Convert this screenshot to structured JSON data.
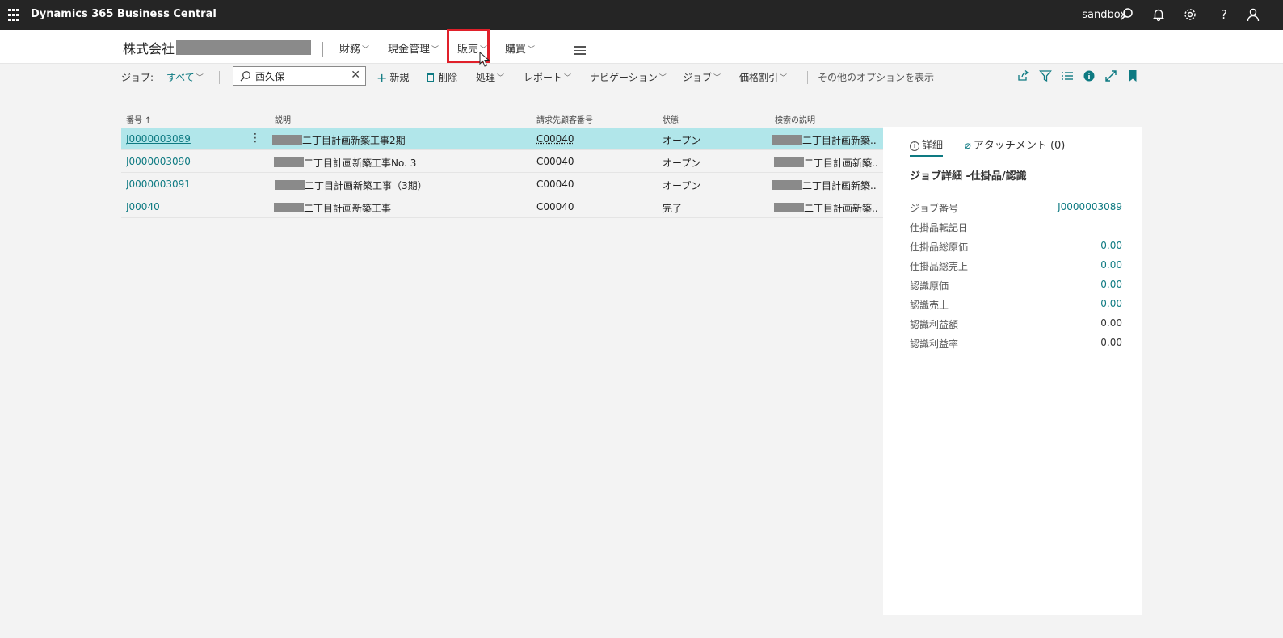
{
  "app": {
    "title": "Dynamics 365 Business Central",
    "environment": "sandbox"
  },
  "nav": {
    "company_prefix": "株式会社",
    "items": [
      {
        "label": "財務"
      },
      {
        "label": "現金管理"
      },
      {
        "label": "販売"
      },
      {
        "label": "購買"
      }
    ]
  },
  "actions": {
    "filter_label": "ジョブ:",
    "filter_value": "すべて",
    "search_value": "西久保",
    "new": "新規",
    "delete": "削除",
    "process": "処理",
    "report": "レポート",
    "navigation": "ナビゲーション",
    "job": "ジョブ",
    "price_discount": "価格割引",
    "more_options": "その他のオプションを表示"
  },
  "list": {
    "columns": [
      "番号 ↑",
      "説明",
      "請求先顧客番号",
      "状態",
      "検索の説明"
    ],
    "rows": [
      {
        "no": "J0000003089",
        "desc": "二丁目計画新築工事2期",
        "customer": "C00040",
        "status": "オープン",
        "search_desc": "二丁目計画新築..."
      },
      {
        "no": "J0000003090",
        "desc": "二丁目計画新築工事No. 3",
        "customer": "C00040",
        "status": "オープン",
        "search_desc": "二丁目計画新築..."
      },
      {
        "no": "J0000003091",
        "desc": "二丁目計画新築工事（3期）",
        "customer": "C00040",
        "status": "オープン",
        "search_desc": "二丁目計画新築..."
      },
      {
        "no": "J00040",
        "desc": "二丁目計画新築工事",
        "customer": "C00040",
        "status": "完了",
        "search_desc": "二丁目計画新築..."
      }
    ]
  },
  "factbox": {
    "tab_details": "詳細",
    "tab_attachments": "アタッチメント (0)",
    "title": "ジョブ詳細 -仕掛品/認識",
    "fields": [
      {
        "label": "ジョブ番号",
        "value": "J0000003089"
      },
      {
        "label": "仕掛品転記日",
        "value": ""
      },
      {
        "label": "仕掛品総原価",
        "value": "0.00"
      },
      {
        "label": "仕掛品総売上",
        "value": "0.00"
      },
      {
        "label": "認識原価",
        "value": "0.00"
      },
      {
        "label": "認識売上",
        "value": "0.00"
      },
      {
        "label": "認識利益額",
        "value": "0.00"
      },
      {
        "label": "認識利益率",
        "value": "0.00"
      }
    ]
  },
  "colors": {
    "accent": "#0e7a82",
    "selected_row": "#b1e6ea",
    "appbar": "#252525",
    "highlight": "#e0202a"
  }
}
